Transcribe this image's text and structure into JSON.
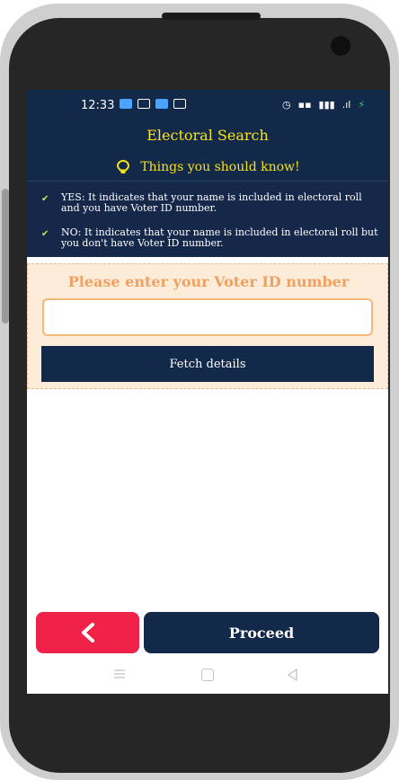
{
  "status_bar": {
    "time": "12:33"
  },
  "header": {
    "title": "Electoral Search",
    "tips_label": "Things you should know!"
  },
  "info": {
    "items": [
      {
        "text": "YES: It indicates that your name is included in electoral roll and you have Voter ID number."
      },
      {
        "text": "NO: It indicates that your name is included in electoral roll but you don't have Voter ID number."
      }
    ]
  },
  "form": {
    "title": "Please enter your Voter ID number",
    "input_value": "",
    "fetch_label": "Fetch details"
  },
  "actions": {
    "proceed_label": "Proceed"
  },
  "colors": {
    "primary_navy": "#13294a",
    "accent_yellow": "#f6e11b",
    "form_orange": "#f0a062",
    "back_red": "#f0224a"
  },
  "icons": [
    "bulb-icon",
    "check-icon",
    "back-arrow-icon",
    "menu-icon",
    "home-icon",
    "nav-back-icon"
  ]
}
